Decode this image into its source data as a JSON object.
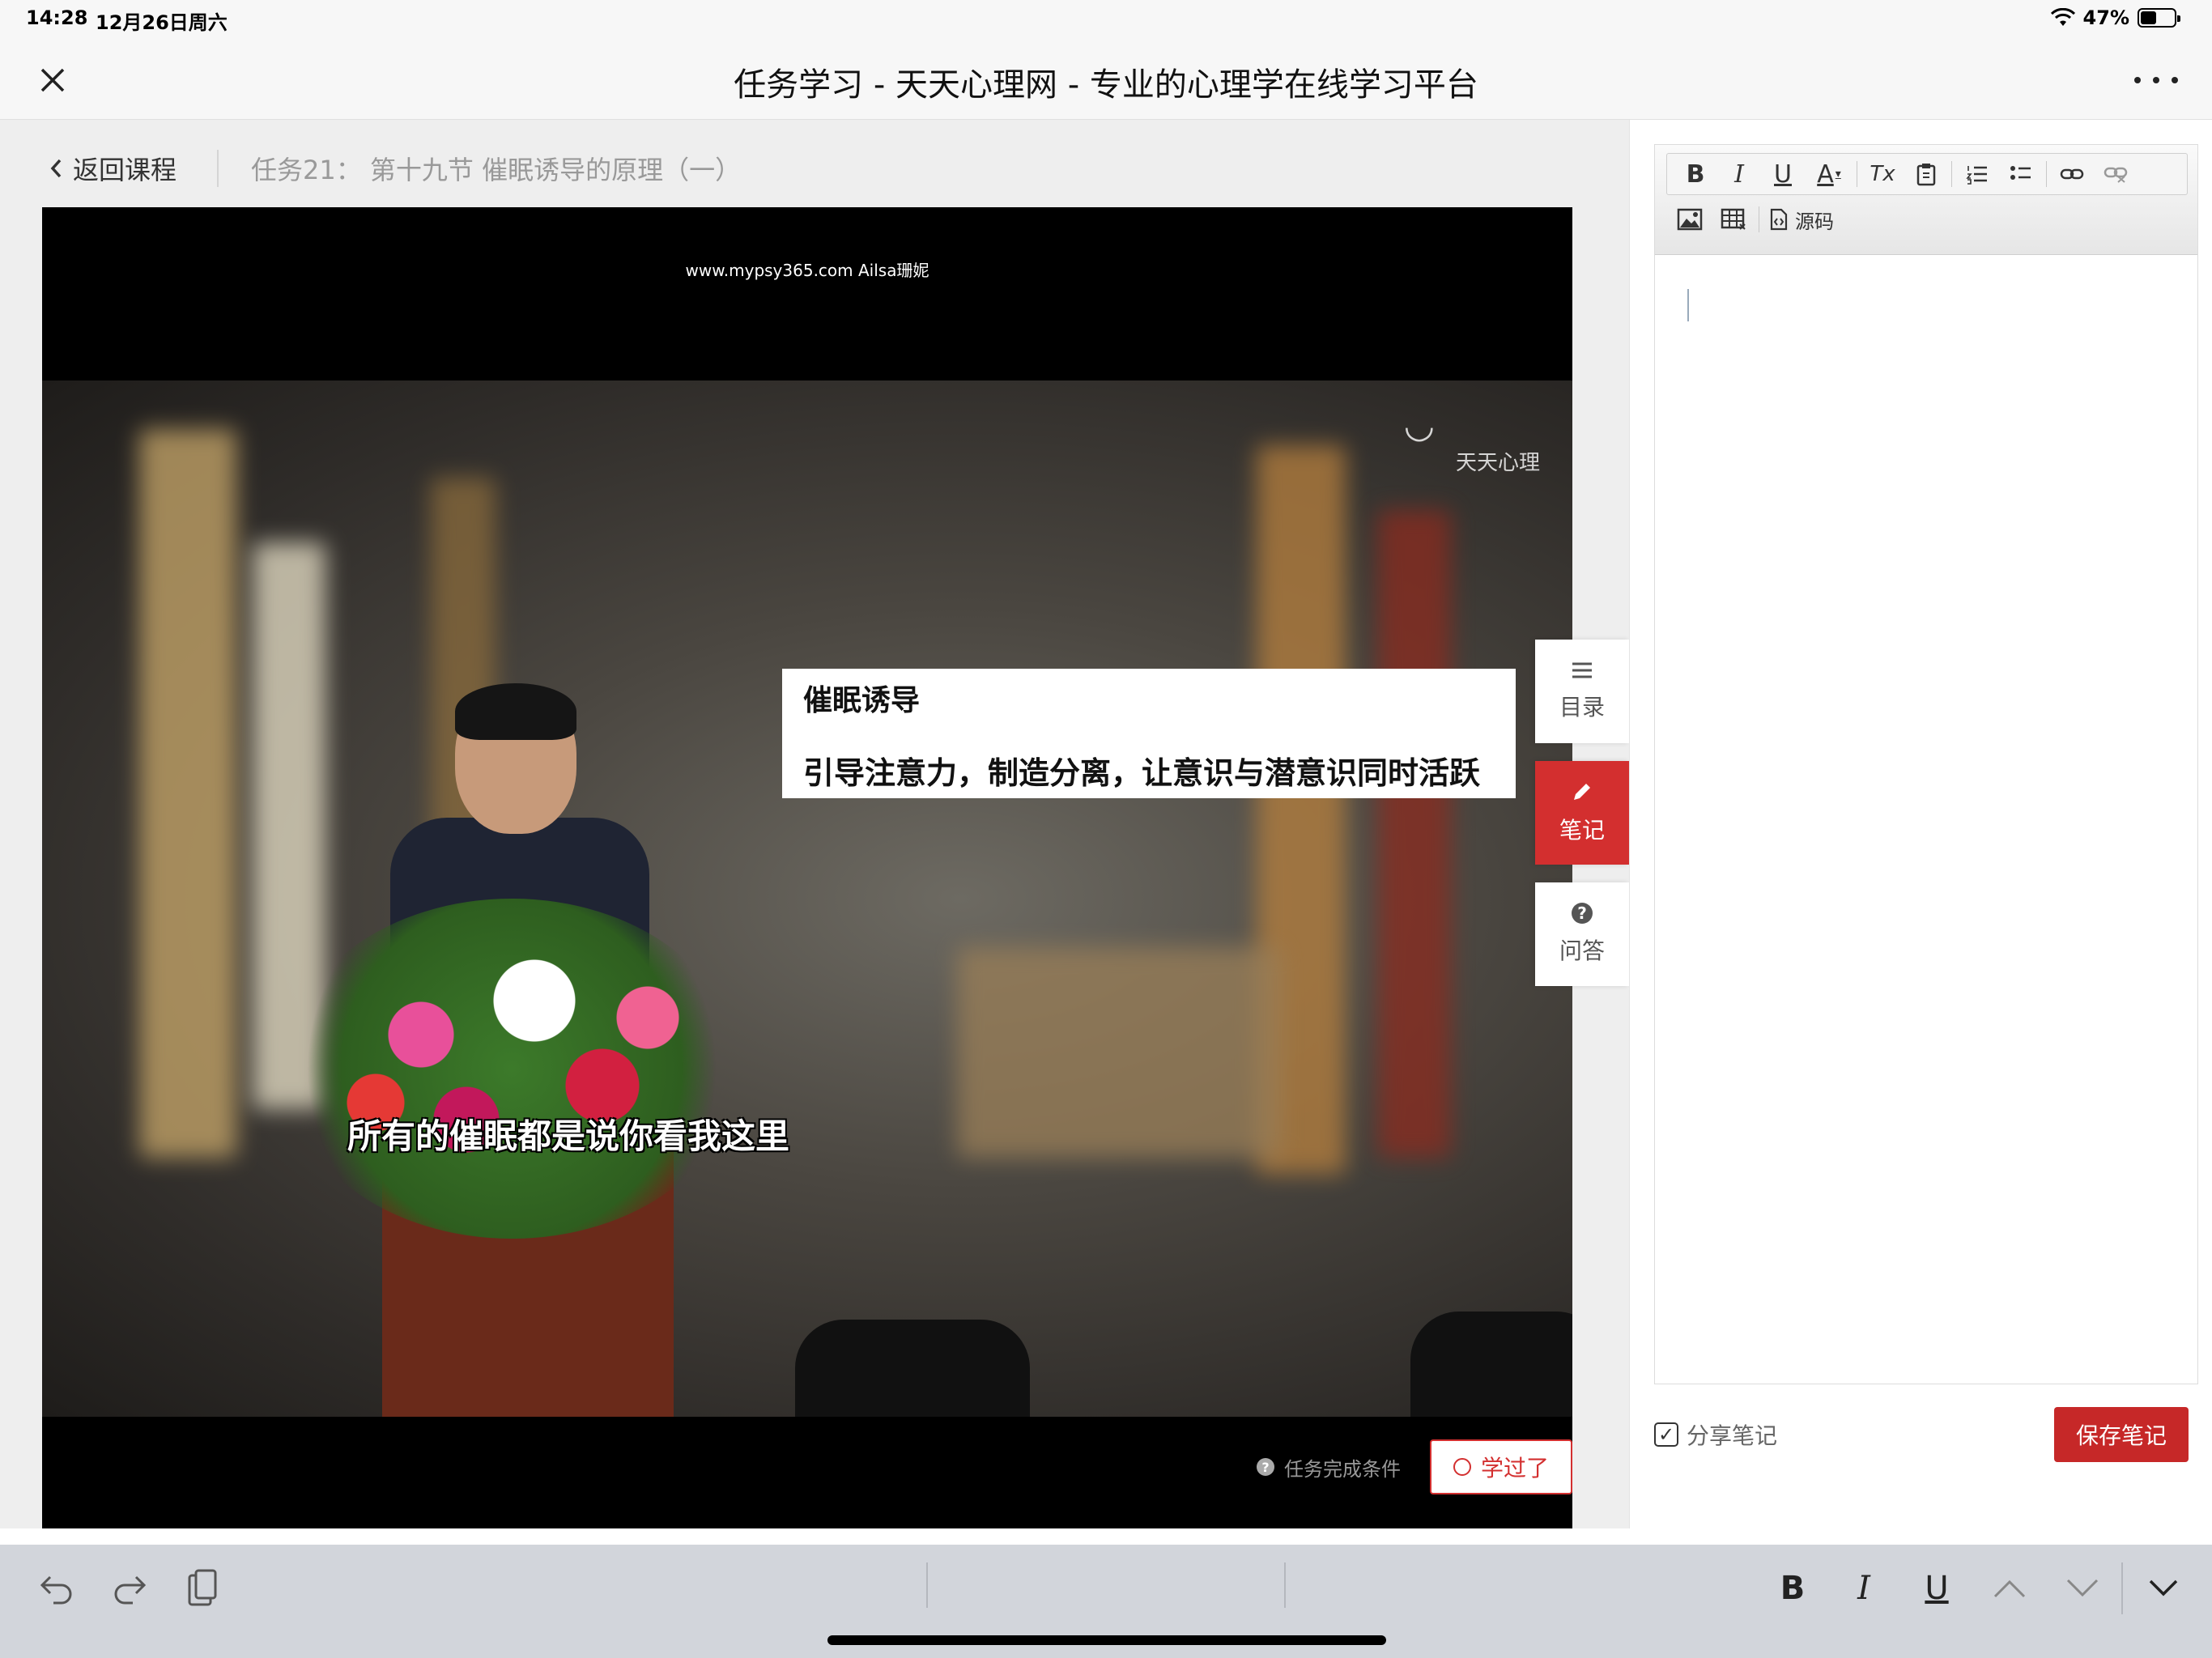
{
  "status_bar": {
    "time": "14:28",
    "date": "12月26日周六",
    "battery": "47%",
    "battery_level": 0.47
  },
  "nav": {
    "title": "任务学习 - 天天心理网 - 专业的心理学在线学习平台",
    "close_icon": "close-icon",
    "more_icon": "more-icon"
  },
  "breadcrumb": {
    "back_label": "返回课程",
    "task_title": "任务21： 第十九节 催眠诱导的原理（一）"
  },
  "video": {
    "watermark": "www.mypsy365.com Ailsa珊妮",
    "logo_text": "天天心理",
    "slide_heading": "催眠诱导",
    "slide_body": "引导注意力，制造分离，让意识与潜意识同时活跃",
    "subtitle": "所有的催眠都是说你看我这里"
  },
  "side_tabs": [
    {
      "label": "目录",
      "icon": "list-icon"
    },
    {
      "label": "笔记",
      "icon": "pencil-icon",
      "active": true
    },
    {
      "label": "问答",
      "icon": "question-icon"
    }
  ],
  "task_footer": {
    "condition_label": "任务完成条件",
    "learned_label": "学过了"
  },
  "editor": {
    "toolbar": [
      "B",
      "I",
      "U",
      "A",
      "Tx"
    ],
    "source_label": "源码"
  },
  "notes_footer": {
    "share_label": "分享笔记",
    "share_checked": true,
    "save_label": "保存笔记"
  },
  "keyboard_bar": {
    "bold": "B",
    "italic": "I",
    "underline": "U"
  },
  "colors": {
    "accent": "#d32f2f",
    "page_bg": "#eeeeee"
  }
}
